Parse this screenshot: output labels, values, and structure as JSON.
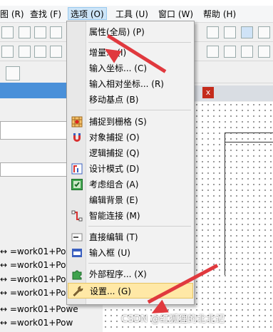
{
  "menubar": {
    "items": [
      {
        "label": "图 (R)"
      },
      {
        "label": "查找 (F)"
      },
      {
        "label": "选项 (O)"
      },
      {
        "label": "工具 (U)"
      },
      {
        "label": "窗口 (W)"
      },
      {
        "label": "帮助 (H)"
      }
    ]
  },
  "menu": {
    "items": [
      {
        "label": "属性(全局) (P)",
        "icon": "none"
      },
      {
        "label": "增量... (I)",
        "icon": "none"
      },
      {
        "label": "输入坐标... (C)",
        "icon": "none"
      },
      {
        "label": "输入相对坐标... (R)",
        "icon": "none"
      },
      {
        "label": "移动基点 (B)",
        "icon": "none"
      },
      {
        "label": "捕捉到栅格 (S)",
        "icon": "grid-snap-icon"
      },
      {
        "label": "对象捕捉 (O)",
        "icon": "magnet-icon"
      },
      {
        "label": "逻辑捕捉 (Q)",
        "icon": "none"
      },
      {
        "label": "设计模式 (D)",
        "icon": "design-mode-icon"
      },
      {
        "label": "考虑组合 (A)",
        "icon": "group-icon"
      },
      {
        "label": "编辑背景 (E)",
        "icon": "none"
      },
      {
        "label": "智能连接 (M)",
        "icon": "smart-connect-icon"
      },
      {
        "label": "直接编辑 (T)",
        "icon": "direct-edit-icon"
      },
      {
        "label": "输入框 (U)",
        "icon": "input-box-icon"
      },
      {
        "label": "外部程序... (X)",
        "icon": "puzzle-icon"
      },
      {
        "label": "设置... (G)",
        "icon": "wrench-icon"
      }
    ]
  },
  "list": {
    "rows": [
      "↔ =work01+Pow",
      "↔ =work01+Pow",
      "↔ =work01+Pow",
      "↔ =work01+Pow",
      "↔ =work01+Power",
      "↔ =work01+Pow"
    ]
  },
  "tab": {
    "close": "x"
  },
  "watermark": "CSDN @红狐狸的北北记",
  "colors": {
    "highlight": "#ffe8a6",
    "arrow": "#e0393e",
    "menubar_active": "#cce4f7"
  }
}
